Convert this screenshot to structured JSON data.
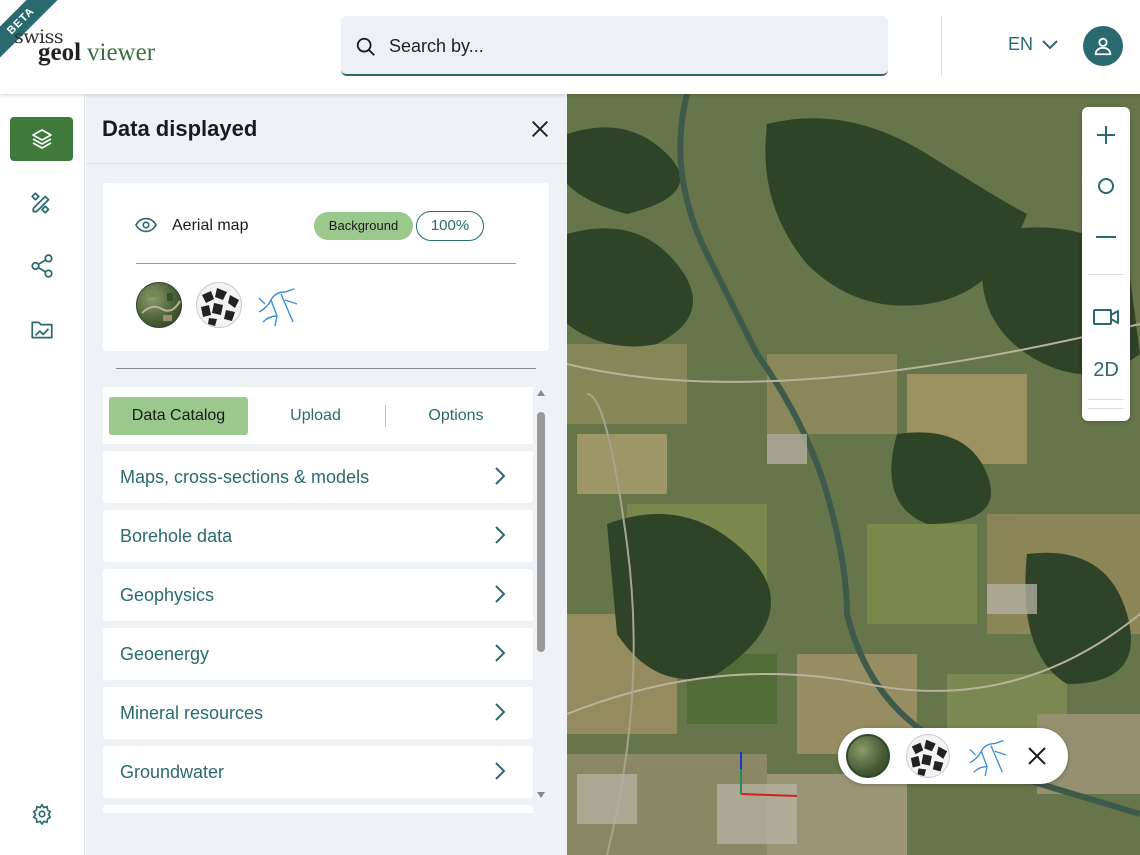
{
  "header": {
    "beta": "BETA",
    "logo_swiss": "swiss",
    "logo_geol": "geol",
    "logo_viewer": "viewer",
    "search_placeholder": "Search by...",
    "language": "EN"
  },
  "panel": {
    "title": "Data displayed",
    "layer": {
      "name": "Aerial map",
      "badge": "Background",
      "opacity": "100%"
    },
    "backgrounds": [
      "aerial-thumbnail",
      "grey-map-thumbnail",
      "waters-thumbnail"
    ],
    "tabs": [
      {
        "label": "Data Catalog",
        "active": true
      },
      {
        "label": "Upload",
        "active": false
      },
      {
        "label": "Options",
        "active": false
      }
    ],
    "catalog": [
      {
        "label": "Maps, cross-sections & models"
      },
      {
        "label": "Borehole data"
      },
      {
        "label": "Geophysics"
      },
      {
        "label": "Geoenergy"
      },
      {
        "label": "Mineral resources"
      },
      {
        "label": "Groundwater"
      }
    ]
  },
  "map": {
    "nav_2d": "2D"
  },
  "colors": {
    "accent": "#2a6a6f",
    "active_green": "#3f7a3c",
    "badge_green": "#9bc98d"
  }
}
